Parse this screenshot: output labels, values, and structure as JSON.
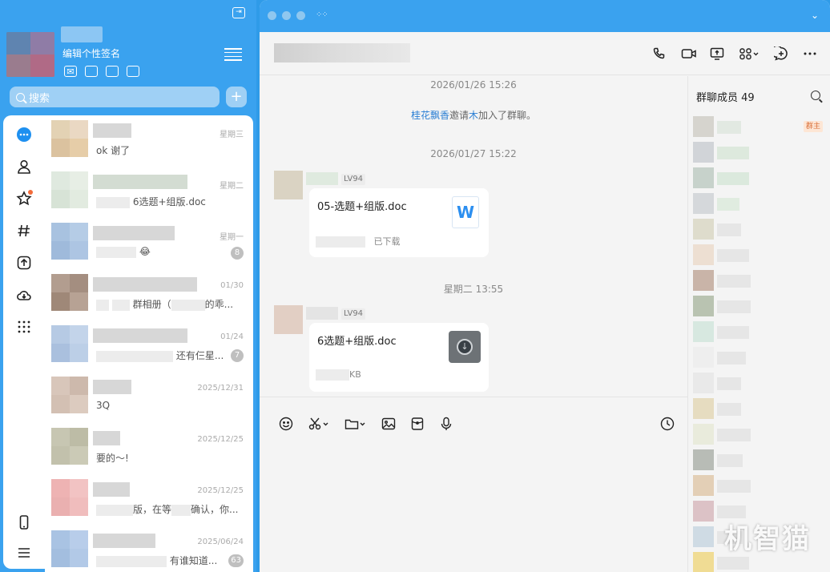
{
  "profile": {
    "signature": "编辑个性签名"
  },
  "search": {
    "placeholder": "搜索"
  },
  "conversations": [
    {
      "time": "星期三",
      "preview": "ok 谢了",
      "count": ""
    },
    {
      "time": "星期二",
      "preview": "6选题+组版.doc",
      "count": ""
    },
    {
      "time": "星期一",
      "preview": "😂",
      "count": "8"
    },
    {
      "time": "01/30",
      "preview": "群相册（",
      "preview_tail": "的乖...",
      "count": ""
    },
    {
      "time": "01/24",
      "preview": "还有仨星...",
      "count": "7"
    },
    {
      "time": "2025/12/31",
      "preview": "3Q",
      "count": ""
    },
    {
      "time": "2025/12/25",
      "preview": "要的～!",
      "count": ""
    },
    {
      "time": "2025/12/25",
      "preview": "版，在等",
      "preview_tail": "确认，你...",
      "count": ""
    },
    {
      "time": "2025/06/24",
      "preview": "有谁知道...",
      "count": "63"
    }
  ],
  "chat": {
    "stamp1": "2026/01/26 15:26",
    "system": {
      "inviter": "桂花飘香",
      "verb": "邀请",
      "invitee": "木",
      "tail": "加入了群聊。"
    },
    "stamp2": "2026/01/27 15:22",
    "msg1": {
      "level": "LV94",
      "file_name": "05-选题+组版.doc",
      "status": "已下载",
      "icon_letter": "W"
    },
    "stamp3": "星期二 13:55",
    "msg2": {
      "level": "LV94",
      "file_name": "6选题+组版.doc",
      "size": "KB"
    }
  },
  "members": {
    "title": "群聊成员 49",
    "owner_badge": "群主"
  },
  "watermark": "机智猫",
  "colors": {
    "accent": "#3aa2ef",
    "link": "#2b7fd4"
  }
}
